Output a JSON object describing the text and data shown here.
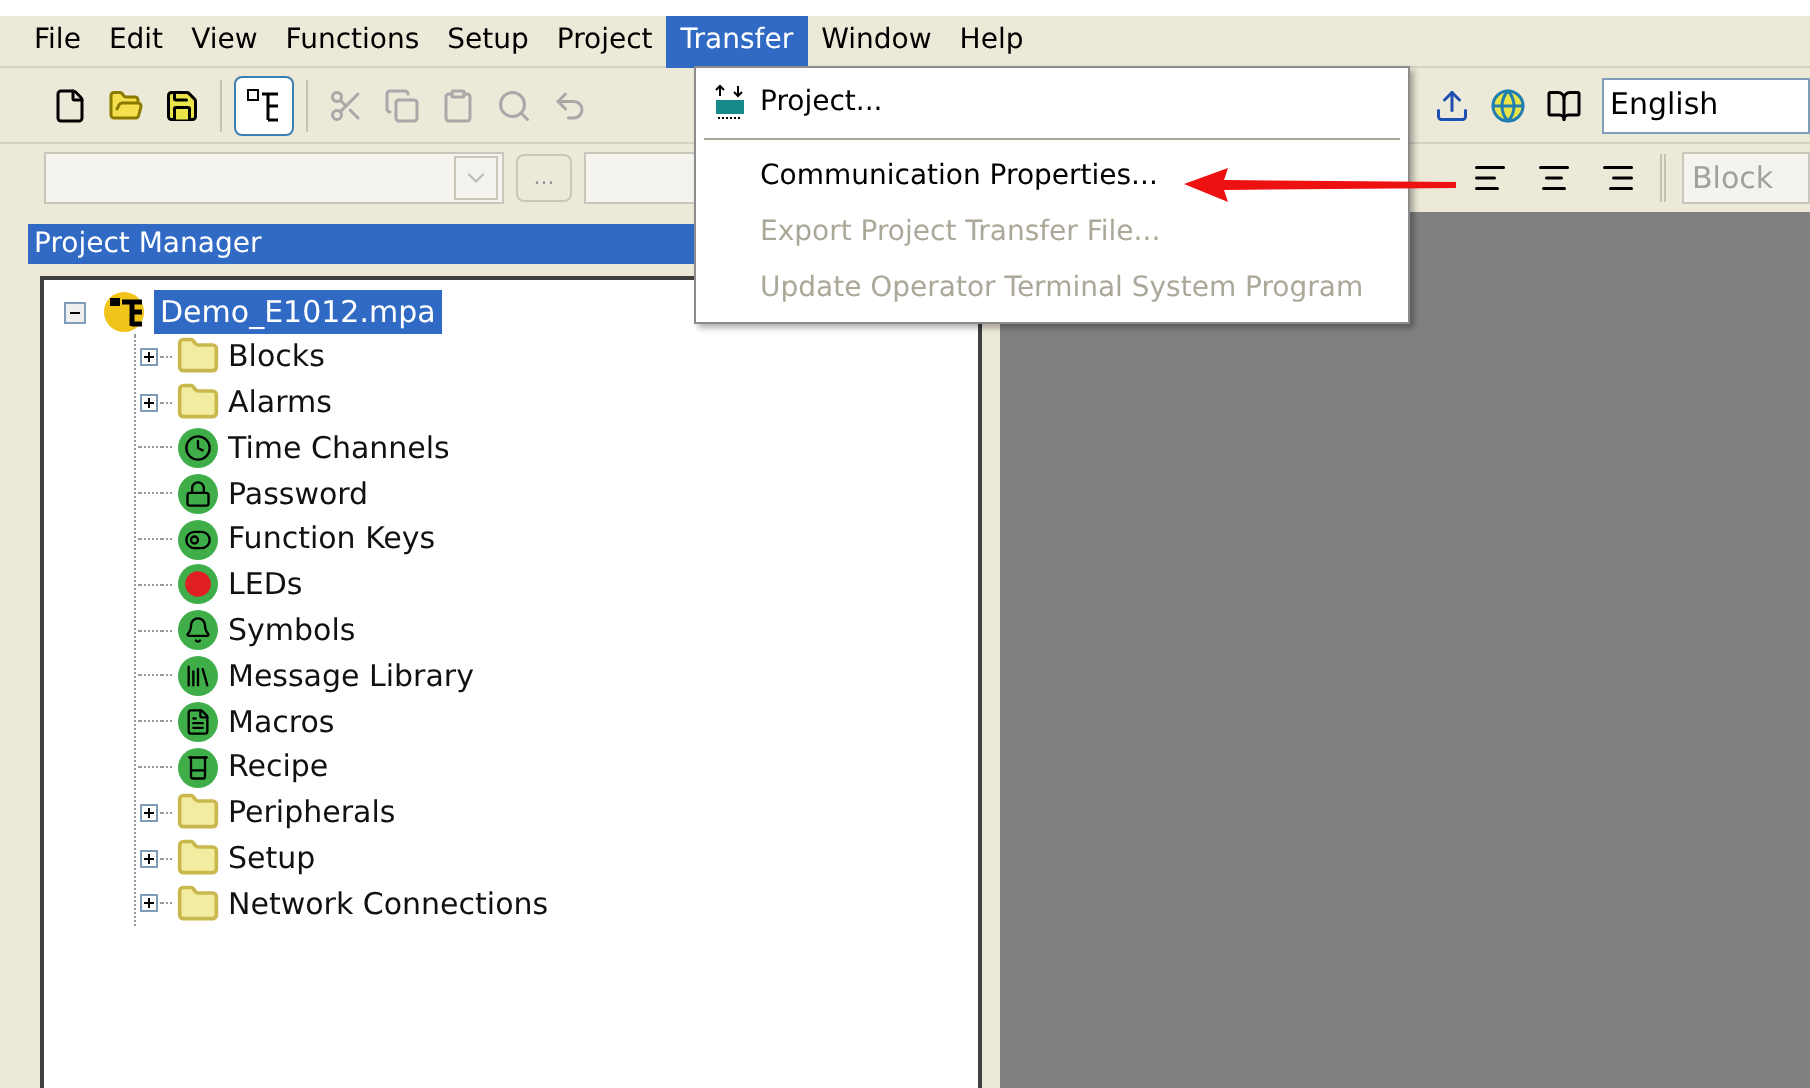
{
  "menu_bar": [
    {
      "label": "File",
      "selected": false
    },
    {
      "label": "Edit",
      "selected": false
    },
    {
      "label": "View",
      "selected": false
    },
    {
      "label": "Functions",
      "selected": false
    },
    {
      "label": "Setup",
      "selected": false
    },
    {
      "label": "Project",
      "selected": false
    },
    {
      "label": "Transfer",
      "selected": true
    },
    {
      "label": "Window",
      "selected": false
    },
    {
      "label": "Help",
      "selected": false
    }
  ],
  "toolbar": {
    "tree_view_pressed": true,
    "language": "English"
  },
  "format_bar": {
    "browse_button": "...",
    "block_field": "Block"
  },
  "transfer_menu": [
    {
      "label": "Project...",
      "kind": "item",
      "icon": true,
      "disabled": false
    },
    {
      "kind": "separator"
    },
    {
      "label": "Communication Properties...",
      "kind": "item",
      "icon": false,
      "disabled": false
    },
    {
      "label": "Export Project Transfer File...",
      "kind": "item",
      "icon": false,
      "disabled": true
    },
    {
      "label": "Update Operator Terminal System Program",
      "kind": "item",
      "icon": false,
      "disabled": true
    }
  ],
  "project_manager": {
    "title": "Project Manager",
    "tree": {
      "label": "Demo_E1012.mpa",
      "selected": true,
      "expanded": true,
      "children": [
        {
          "label": "Blocks",
          "kind": "folder",
          "expanded": false
        },
        {
          "label": "Alarms",
          "kind": "folder",
          "expanded": false
        },
        {
          "label": "Time Channels",
          "kind": "clock"
        },
        {
          "label": "Password",
          "kind": "lock"
        },
        {
          "label": "Function Keys",
          "kind": "toggle"
        },
        {
          "label": "LEDs",
          "kind": "leds"
        },
        {
          "label": "Symbols",
          "kind": "symbol"
        },
        {
          "label": "Message Library",
          "kind": "library"
        },
        {
          "label": "Macros",
          "kind": "macro"
        },
        {
          "label": "Recipe",
          "kind": "recipe"
        },
        {
          "label": "Peripherals",
          "kind": "folder",
          "expanded": false
        },
        {
          "label": "Setup",
          "kind": "folder",
          "expanded": false
        },
        {
          "label": "Network Connections",
          "kind": "folder",
          "expanded": false
        }
      ]
    }
  }
}
